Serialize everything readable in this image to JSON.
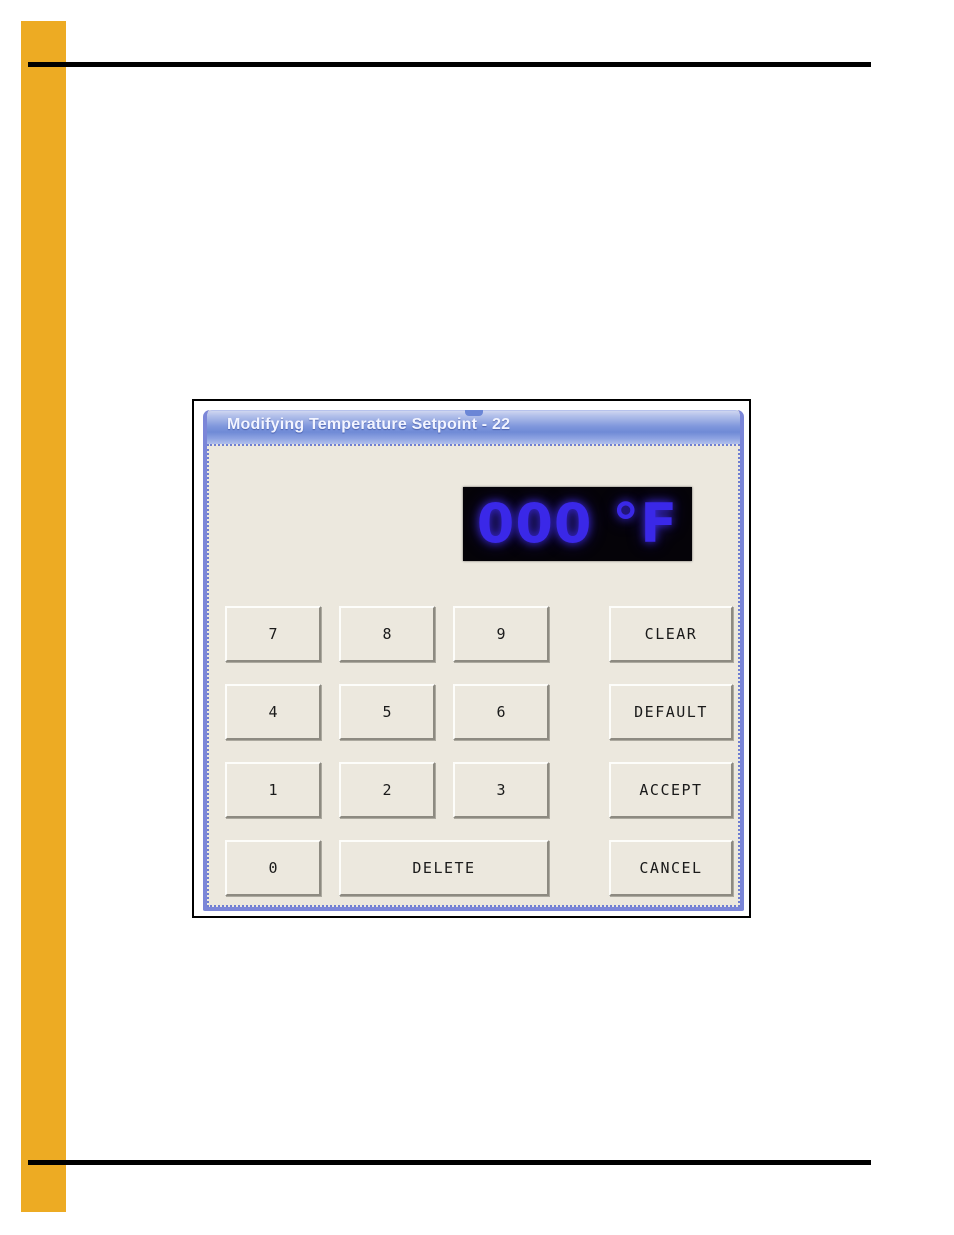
{
  "page": {
    "sidebar_color": "#edab23",
    "rule_color": "#000000"
  },
  "dialog": {
    "title": "Modifying Temperature Setpoint - 22",
    "titlebar_color": "#7e96dc",
    "border_color": "#7b86d8",
    "body_color": "#ece8de",
    "display": {
      "value": "000 °F",
      "number": "000",
      "unit": "°F",
      "text_color": "#3a28e8",
      "background_color": "#050308"
    },
    "keypad": {
      "rows": [
        {
          "keys": [
            {
              "label": "7",
              "name": "key-7",
              "type": "digit"
            },
            {
              "label": "8",
              "name": "key-8",
              "type": "digit"
            },
            {
              "label": "9",
              "name": "key-9",
              "type": "digit"
            },
            {
              "label": "CLEAR",
              "name": "clear-button",
              "type": "action"
            }
          ]
        },
        {
          "keys": [
            {
              "label": "4",
              "name": "key-4",
              "type": "digit"
            },
            {
              "label": "5",
              "name": "key-5",
              "type": "digit"
            },
            {
              "label": "6",
              "name": "key-6",
              "type": "digit"
            },
            {
              "label": "DEFAULT",
              "name": "default-button",
              "type": "action"
            }
          ]
        },
        {
          "keys": [
            {
              "label": "1",
              "name": "key-1",
              "type": "digit"
            },
            {
              "label": "2",
              "name": "key-2",
              "type": "digit"
            },
            {
              "label": "3",
              "name": "key-3",
              "type": "digit"
            },
            {
              "label": "ACCEPT",
              "name": "accept-button",
              "type": "action"
            }
          ]
        },
        {
          "keys": [
            {
              "label": "0",
              "name": "key-0",
              "type": "digit"
            },
            {
              "label": "DELETE",
              "name": "delete-button",
              "type": "action"
            },
            {
              "label": "CANCEL",
              "name": "cancel-button",
              "type": "action"
            }
          ]
        }
      ]
    }
  }
}
